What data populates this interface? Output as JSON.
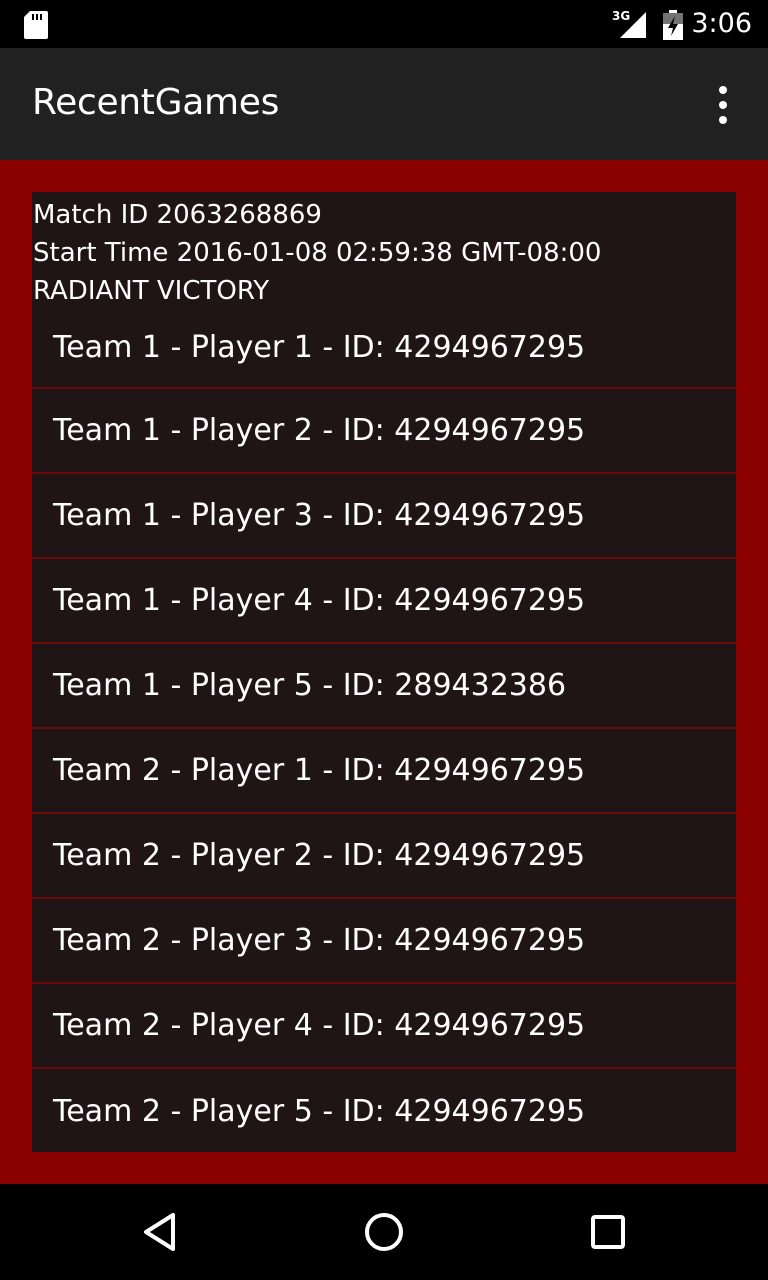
{
  "status_bar": {
    "network_type": "3G",
    "time": "3:06",
    "icons": [
      "sd-card-icon",
      "signal-icon",
      "battery-icon"
    ]
  },
  "app_bar": {
    "title": "RecentGames",
    "menu_icon": "overflow-menu-icon"
  },
  "match": {
    "match_id_line": "Match ID 2063268869",
    "start_time_line": "Start Time 2016-01-08 02:59:38 GMT-08:00",
    "result": "RADIANT VICTORY",
    "players": [
      "Team 1 - Player 1 - ID: 4294967295",
      "Team 1 - Player 2 - ID: 4294967295",
      "Team 1 - Player 3 - ID: 4294967295",
      "Team 1 - Player 4 - ID: 4294967295",
      "Team 1 - Player 5 - ID: 289432386",
      "Team 2 - Player 1 - ID: 4294967295",
      "Team 2 - Player 2 - ID: 4294967295",
      "Team 2 - Player 3 - ID: 4294967295",
      "Team 2 - Player 4 - ID: 4294967295",
      "Team 2 - Player 5 - ID: 4294967295"
    ]
  },
  "nav_bar": {
    "icons": [
      "back-icon",
      "home-icon",
      "recents-icon"
    ]
  },
  "colors": {
    "background": "#8b0000",
    "app_bar": "#212121",
    "card": "#1f1416",
    "divider": "#6b0a0a",
    "text": "#ffffff"
  }
}
